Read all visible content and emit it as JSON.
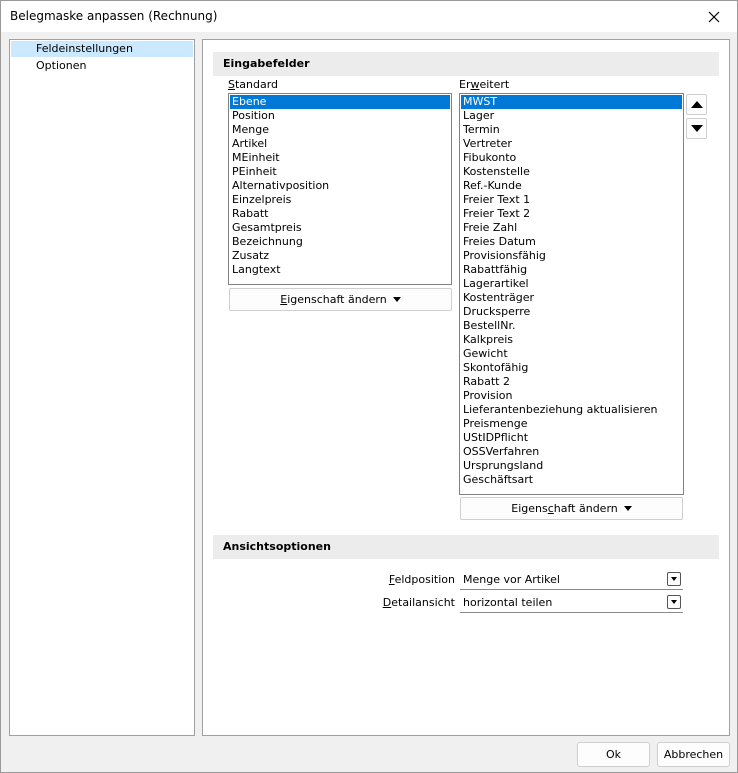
{
  "window": {
    "title": "Belegmaske anpassen (Rechnung)",
    "close_icon": "close-icon"
  },
  "nav": {
    "items": [
      {
        "label": "Feldeinstellungen",
        "selected": true
      },
      {
        "label": "Optionen",
        "selected": false
      }
    ]
  },
  "eingabefelder": {
    "header": "Eingabefelder",
    "standard": {
      "label_underlined": "S",
      "label_rest": "tandard",
      "items": [
        "Ebene",
        "Position",
        "Menge",
        "Artikel",
        "MEinheit",
        "PEinheit",
        "Alternativposition",
        "Einzelpreis",
        "Rabatt",
        "Gesamtpreis",
        "Bezeichnung",
        "Zusatz",
        "Langtext"
      ],
      "selected_index": 0,
      "button_underlined": "E",
      "button_rest": "igenschaft ändern"
    },
    "erweitert": {
      "label_pre": "Er",
      "label_underlined": "w",
      "label_rest": "eitert",
      "items": [
        "MWST",
        "Lager",
        "Termin",
        "Vertreter",
        "Fibukonto",
        "Kostenstelle",
        "Ref.-Kunde",
        "Freier Text 1",
        "Freier Text 2",
        "Freie Zahl",
        "Freies Datum",
        "Provisionsfähig",
        "Rabattfähig",
        "Lagerartikel",
        "Kostenträger",
        "Drucksperre",
        "BestellNr.",
        "Kalkpreis",
        "Gewicht",
        "Skontofähig",
        "Rabatt 2",
        "Provision",
        "Lieferantenbeziehung aktualisieren",
        "Preismenge",
        "UStIDPflicht",
        "OSSVerfahren",
        "Ursprungsland",
        "Geschäftsart"
      ],
      "selected_index": 0,
      "button_pre": "Eigens",
      "button_underlined": "c",
      "button_rest": "haft ändern"
    },
    "move_up_icon": "arrow-up-icon",
    "move_down_icon": "arrow-down-icon"
  },
  "ansichtsoptionen": {
    "header": "Ansichtsoptionen",
    "feldposition": {
      "label_underlined": "F",
      "label_rest": "eldposition",
      "value": "Menge vor Artikel"
    },
    "detailansicht": {
      "label_underlined": "D",
      "label_rest": "etailansicht",
      "value": "horizontal teilen"
    }
  },
  "buttons": {
    "ok": "Ok",
    "cancel": "Abbrechen"
  },
  "colors": {
    "selection": "#0078d7",
    "nav_selection": "#cce8ff",
    "section_header_bg": "#ececec"
  }
}
